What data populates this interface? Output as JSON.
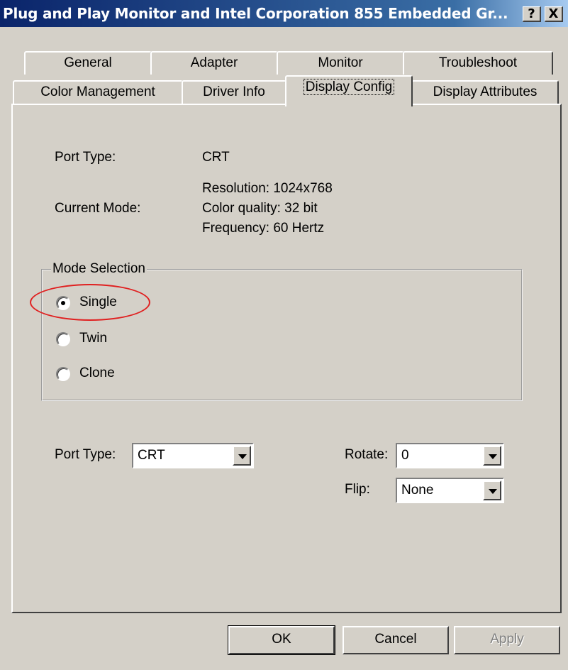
{
  "window": {
    "title": "Plug and Play Monitor and Intel Corporation 855 Embedded Gr...",
    "help_label": "?",
    "close_label": "X"
  },
  "tabs_row1": [
    "General",
    "Adapter",
    "Monitor",
    "Troubleshoot"
  ],
  "tabs_row2": [
    "Color Management",
    "Driver Info",
    "Display Config",
    "Display Attributes"
  ],
  "selected_tab": "Display Config",
  "info": {
    "port_type_label": "Port Type:",
    "port_type_value": "CRT",
    "current_mode_label": "Current Mode:",
    "resolution": "Resolution: 1024x768",
    "color_quality": "Color quality: 32 bit",
    "frequency": "Frequency: 60 Hertz"
  },
  "mode_selection": {
    "legend": "Mode Selection",
    "options": [
      "Single",
      "Twin",
      "Clone"
    ],
    "selected": "Single"
  },
  "controls": {
    "port_type_label": "Port Type:",
    "port_type_value": "CRT",
    "rotate_label": "Rotate:",
    "rotate_value": "0",
    "flip_label": "Flip:",
    "flip_value": "None"
  },
  "buttons": {
    "ok": "OK",
    "cancel": "Cancel",
    "apply": "Apply"
  },
  "colors": {
    "title_bar": "#0a246a",
    "face": "#d4d0c8",
    "highlight_ring": "#e02020"
  }
}
